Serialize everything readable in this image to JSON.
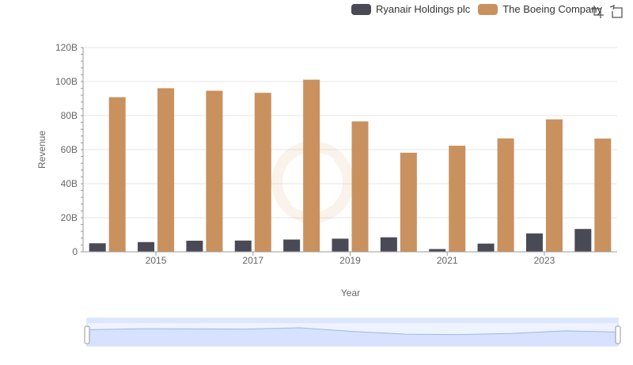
{
  "legend": {
    "items": [
      {
        "label": "Ryanair Holdings plc",
        "color": "#4a4a56"
      },
      {
        "label": "The Boeing Company",
        "color": "#c9915e"
      }
    ]
  },
  "toolbar": {
    "icons": [
      "zoom-select-icon",
      "zoom-reset-icon"
    ]
  },
  "colors": {
    "ryanair": "#4a4a56",
    "boeing": "#c9915e",
    "grid": "#e6e6e6",
    "slider": "#dce6ff"
  },
  "chart_data": {
    "type": "bar",
    "categories": [
      "2014",
      "2015",
      "2016",
      "2017",
      "2018",
      "2019",
      "2020",
      "2021",
      "2022",
      "2023",
      "2024"
    ],
    "series": [
      {
        "name": "Ryanair Holdings plc",
        "values": [
          5.0,
          5.7,
          6.5,
          6.6,
          7.2,
          7.7,
          8.5,
          1.6,
          4.8,
          10.8,
          13.4
        ]
      },
      {
        "name": "The Boeing Company",
        "values": [
          90.8,
          96.1,
          94.6,
          93.4,
          101.1,
          76.6,
          58.2,
          62.3,
          66.6,
          77.8,
          66.5
        ]
      }
    ],
    "xlabel": "Year",
    "ylabel": "Revenue",
    "ylim": [
      0,
      120
    ],
    "yticks": [
      "0",
      "20B",
      "40B",
      "60B",
      "80B",
      "100B",
      "120B"
    ],
    "xticks": [
      "2015",
      "2017",
      "2019",
      "2021",
      "2023"
    ],
    "grid": true,
    "legend_position": "top-right"
  }
}
